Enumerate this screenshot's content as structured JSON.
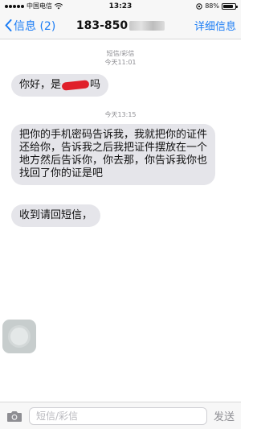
{
  "status_bar": {
    "carrier": "中国电信",
    "time": "13:23",
    "battery_percent": "88%",
    "battery_level": 0.88
  },
  "nav": {
    "back_label": "信息 (2)",
    "title": "183-850",
    "details_label": "详细信息"
  },
  "messages": [
    {
      "timestamp_lines": [
        "短信/彩信",
        "今天11:01"
      ],
      "text_before": "你好，是",
      "text_after": "吗"
    },
    {
      "timestamp_lines": [
        "今天13:15"
      ],
      "text": "把你的手机密码告诉我，我就把你的证件还给你，告诉我之后我把证件摆放在一个地方然后告诉你，你去那，你告诉我你也找回了你的证是吧"
    },
    {
      "text": "收到请回短信，"
    }
  ],
  "input": {
    "placeholder": "短信/彩信",
    "send_label": "发送"
  },
  "colors": {
    "accent": "#1a7cf5",
    "bubble": "#e5e5ea",
    "redaction": "#e0202a"
  }
}
